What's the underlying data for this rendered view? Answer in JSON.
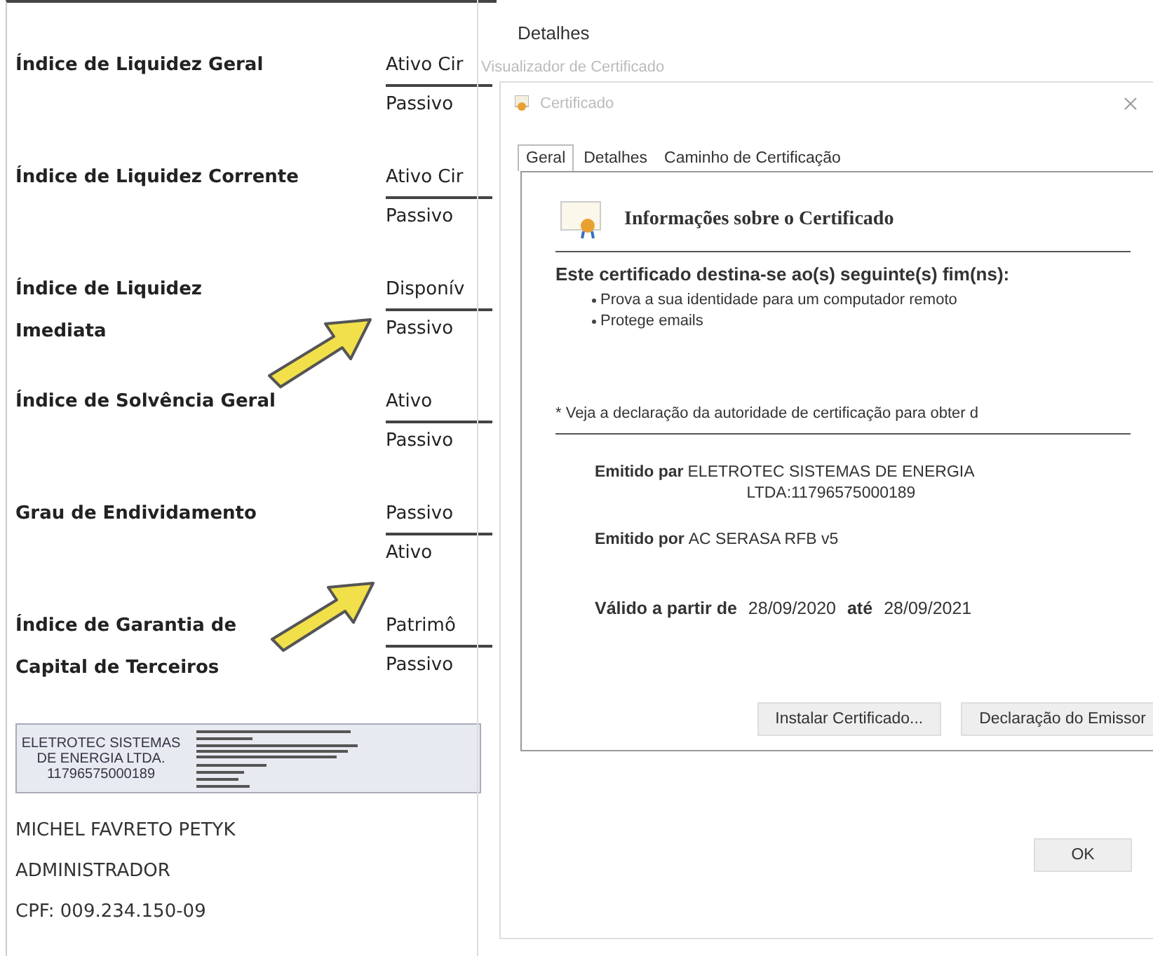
{
  "document": {
    "rows": [
      {
        "label_lines": [
          "Índice de Liquidez Geral"
        ],
        "numerator": "Ativo Cir",
        "denominator": "Passivo"
      },
      {
        "label_lines": [
          "Índice de Liquidez Corrente"
        ],
        "numerator": "Ativo Cir",
        "denominator": "Passivo"
      },
      {
        "label_lines": [
          "Índice de Liquidez",
          "Imediata"
        ],
        "numerator": "Disponív",
        "denominator": "Passivo"
      },
      {
        "label_lines": [
          "Índice de Solvência Geral"
        ],
        "numerator": "Ativo",
        "denominator": "Passivo"
      },
      {
        "label_lines": [
          "Grau de Endividamento"
        ],
        "numerator": "Passivo",
        "denominator": "Ativo"
      },
      {
        "label_lines": [
          "Índice de Garantia de",
          "Capital de Terceiros"
        ],
        "numerator": "Patrimô",
        "denominator": "Passivo"
      }
    ],
    "stamp": [
      "ELETROTEC SISTEMAS",
      "DE ENERGIA LTDA.",
      "11796575000189"
    ],
    "signer": [
      "MICHEL FAVRETO PETYK",
      "ADMINISTRADOR",
      "CPF: 009.234.150-09"
    ]
  },
  "background_window": {
    "tab_label": "Detalhes",
    "title": "Visualizador de Certificado"
  },
  "dialog": {
    "title": "Certificado",
    "tabs": [
      {
        "label": "Geral",
        "selected": true
      },
      {
        "label": "Detalhes",
        "selected": false
      },
      {
        "label": "Caminho de Certificação",
        "selected": false
      }
    ],
    "heading": "Informações sobre o Certificado",
    "purpose_title": "Este certificado destina-se ao(s) seguinte(s) fim(ns):",
    "purposes": [
      "Prova a sua identidade para um computador remoto",
      "Protege emails"
    ],
    "note": "* Veja a declaração da autoridade de certificação para obter d",
    "fields": [
      {
        "label": "Emitido par",
        "value_lines": [
          "ELETROTEC SISTEMAS DE ENERGIA",
          "LTDA:11796575000189"
        ]
      },
      {
        "label": "Emitido por",
        "value_lines": [
          "AC SERASA RFB v5"
        ]
      }
    ],
    "validity": {
      "from_label": "Válido a partir de",
      "from": "28/09/2020",
      "to_label": "até",
      "to": "28/09/2021"
    },
    "buttons": [
      "Instalar Certificado...",
      "Declaração do Emissor"
    ],
    "ok": "OK"
  }
}
